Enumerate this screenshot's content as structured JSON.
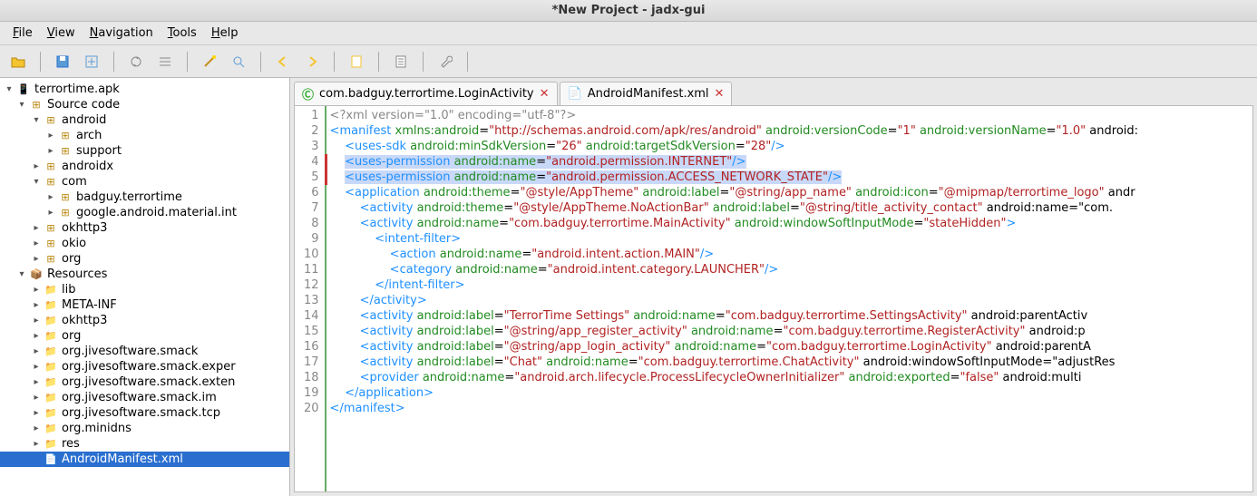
{
  "window": {
    "title": "*New Project - jadx-gui"
  },
  "menu": {
    "file": "File",
    "view": "View",
    "navigation": "Navigation",
    "tools": "Tools",
    "help": "Help"
  },
  "tree": {
    "root": "terrortime.apk",
    "source_code": "Source code",
    "android": "android",
    "arch": "arch",
    "support": "support",
    "androidx": "androidx",
    "com": "com",
    "badguy": "badguy.terrortime",
    "gmat": "google.android.material.int",
    "okhttp3": "okhttp3",
    "okio": "okio",
    "org": "org",
    "resources": "Resources",
    "lib": "lib",
    "metainf": "META-INF",
    "r_okhttp3": "okhttp3",
    "r_org": "org",
    "smack": "org.jivesoftware.smack",
    "smack_exper": "org.jivesoftware.smack.exper",
    "smack_exten": "org.jivesoftware.smack.exten",
    "smack_im": "org.jivesoftware.smack.im",
    "smack_tcp": "org.jivesoftware.smack.tcp",
    "minidns": "org.minidns",
    "res": "res",
    "manifest": "AndroidManifest.xml"
  },
  "tabs": {
    "t1": "com.badguy.terrortime.LoginActivity",
    "t2": "AndroidManifest.xml"
  },
  "chart_data": {
    "type": "table",
    "file": "AndroidManifest.xml",
    "lines": [
      "<?xml version=\"1.0\" encoding=\"utf-8\"?>",
      "<manifest xmlns:android=\"http://schemas.android.com/apk/res/android\" android:versionCode=\"1\" android:versionName=\"1.0\" android:",
      "    <uses-sdk android:minSdkVersion=\"26\" android:targetSdkVersion=\"28\"/>",
      "    <uses-permission android:name=\"android.permission.INTERNET\"/>",
      "    <uses-permission android:name=\"android.permission.ACCESS_NETWORK_STATE\"/>",
      "    <application android:theme=\"@style/AppTheme\" android:label=\"@string/app_name\" android:icon=\"@mipmap/terrortime_logo\" andr",
      "        <activity android:theme=\"@style/AppTheme.NoActionBar\" android:label=\"@string/title_activity_contact\" android:name=\"com.",
      "        <activity android:name=\"com.badguy.terrortime.MainActivity\" android:windowSoftInputMode=\"stateHidden\">",
      "            <intent-filter>",
      "                <action android:name=\"android.intent.action.MAIN\"/>",
      "                <category android:name=\"android.intent.category.LAUNCHER\"/>",
      "            </intent-filter>",
      "        </activity>",
      "        <activity android:label=\"TerrorTime Settings\" android:name=\"com.badguy.terrortime.SettingsActivity\" android:parentActiv",
      "        <activity android:label=\"@string/app_register_activity\" android:name=\"com.badguy.terrortime.RegisterActivity\" android:p",
      "        <activity android:label=\"@string/app_login_activity\" android:name=\"com.badguy.terrortime.LoginActivity\" android:parentA",
      "        <activity android:label=\"Chat\" android:name=\"com.badguy.terrortime.ChatActivity\" android:windowSoftInputMode=\"adjustRes",
      "        <provider android:name=\"android.arch.lifecycle.ProcessLifecycleOwnerInitializer\" android:exported=\"false\" android:multi",
      "    </application>",
      "</manifest>"
    ],
    "highlighted_lines": [
      4,
      5
    ]
  }
}
